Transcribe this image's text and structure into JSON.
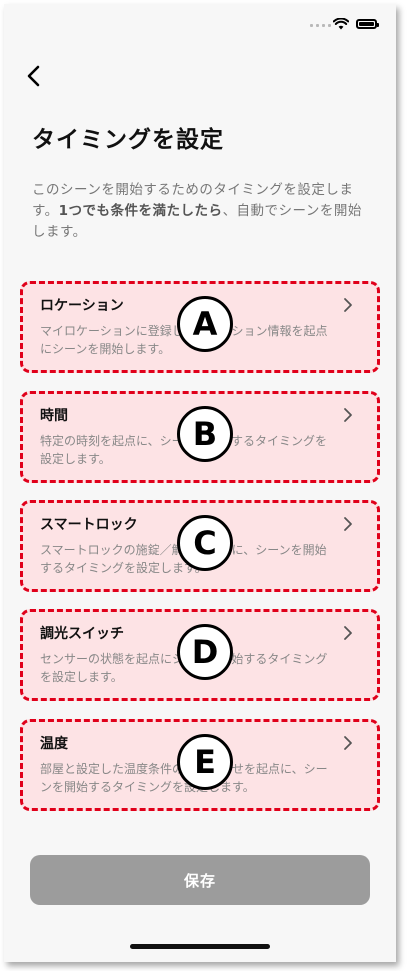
{
  "header": {
    "title": "タイミングを設定",
    "description_part1": "このシーンを開始するためのタイミングを設定します。",
    "description_bold": "1つでも条件を満たしたら",
    "description_part2": "、自動でシーンを開始します。"
  },
  "status_bar": {
    "icons": [
      "signal-icon",
      "wifi-icon",
      "battery-icon"
    ]
  },
  "options": [
    {
      "title": "ロケーション",
      "text": "マイロケーションに登録したロケーション情報を起点にシーンを開始します。",
      "badge": "A"
    },
    {
      "title": "時間",
      "text": "特定の時刻を起点に、シーンを開始するタイミングを設定します。",
      "badge": "B"
    },
    {
      "title": "スマートロック",
      "text": "スマートロックの施錠／解錠を起点に、シーンを開始するタイミングを設定します。",
      "badge": "C"
    },
    {
      "title": "調光スイッチ",
      "text": "センサーの状態を起点にシーンを開始するタイミングを設定します。",
      "badge": "D"
    },
    {
      "title": "温度",
      "text": "部屋と設定した温度条件の組み合わせを起点に、シーンを開始するタイミングを設定します。",
      "badge": "E"
    }
  ],
  "footer": {
    "save_label": "保存"
  },
  "colors": {
    "highlight_border": "#e0001a",
    "highlight_fill": "#fde3e5",
    "save_button": "#9c9c9c"
  }
}
